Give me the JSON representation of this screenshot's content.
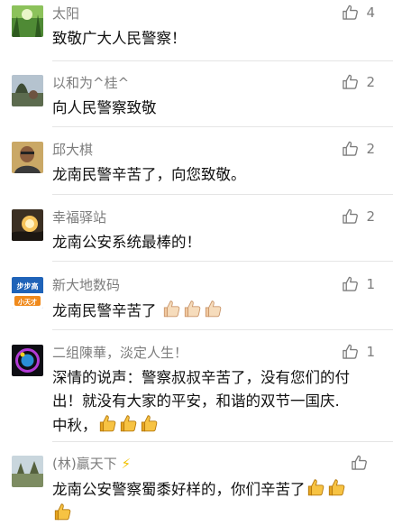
{
  "comments": [
    {
      "name": "太阳",
      "likes": "4",
      "text": "致敬广大人民警察！"
    },
    {
      "name": "以和为^桂^",
      "likes": "2",
      "text": "向人民警察致敬"
    },
    {
      "name": "邱大棋",
      "likes": "2",
      "text": "龙南民警辛苦了，向您致敬。"
    },
    {
      "name": "幸福驿站",
      "likes": "2",
      "text": "龙南公安系统最棒的！"
    },
    {
      "name": "新大地数码",
      "likes": "1",
      "text": "龙南民警辛苦了"
    },
    {
      "name": "二组陳華，淡定人生！",
      "likes": "1",
      "text_line1": "深情的说声：警察叔叔辛苦了，没有您们的付",
      "text_line2": "出！就没有大家的平安，和谐的双节一国庆.",
      "text_line3": "中秋，"
    },
    {
      "name": "(林)贏天下",
      "likes": "",
      "text": "龙南公安警察蜀黍好样的，你们辛苦了"
    }
  ],
  "avatar_logo": {
    "brand_top": "步步高",
    "brand_bottom": "小天才"
  },
  "colors": {
    "name": "#7d7d7d",
    "text": "#111111",
    "divider": "#e5e5e5"
  }
}
